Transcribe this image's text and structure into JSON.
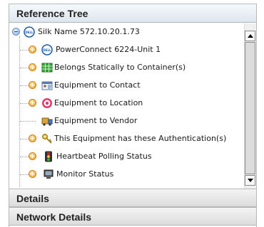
{
  "panel": {
    "reference_tree_title": "Reference Tree",
    "details_title": "Details",
    "network_details_title": "Network Details"
  },
  "tree": {
    "root": {
      "label": "Silk Name 572.10.20.1.73",
      "icon": "dell-logo-icon",
      "expanded": true
    },
    "children": [
      {
        "label": "PowerConnect 6224-Unit 1",
        "icon": "dell-logo-icon",
        "expandable": true
      },
      {
        "label": "Belongs Statically to Container(s)",
        "icon": "grid-container-icon",
        "expandable": true
      },
      {
        "label": "Equipment to Contact",
        "icon": "contact-card-icon",
        "expandable": true
      },
      {
        "label": "Equipment to Location",
        "icon": "location-target-icon",
        "expandable": true
      },
      {
        "label": "Equipment to Vendor",
        "icon": "vendor-truck-icon",
        "expandable": false
      },
      {
        "label": "This Equipment has these Authentication(s)",
        "icon": "key-icon",
        "expandable": true
      },
      {
        "label": "Heartbeat Polling Status",
        "icon": "traffic-light-icon",
        "expandable": true
      },
      {
        "label": "Monitor Status",
        "icon": "monitor-status-icon",
        "expandable": true
      }
    ]
  },
  "colors": {
    "expand_toggle": "#f0a020",
    "collapse_toggle": "#8ab0e0",
    "header_text": "#222222"
  }
}
